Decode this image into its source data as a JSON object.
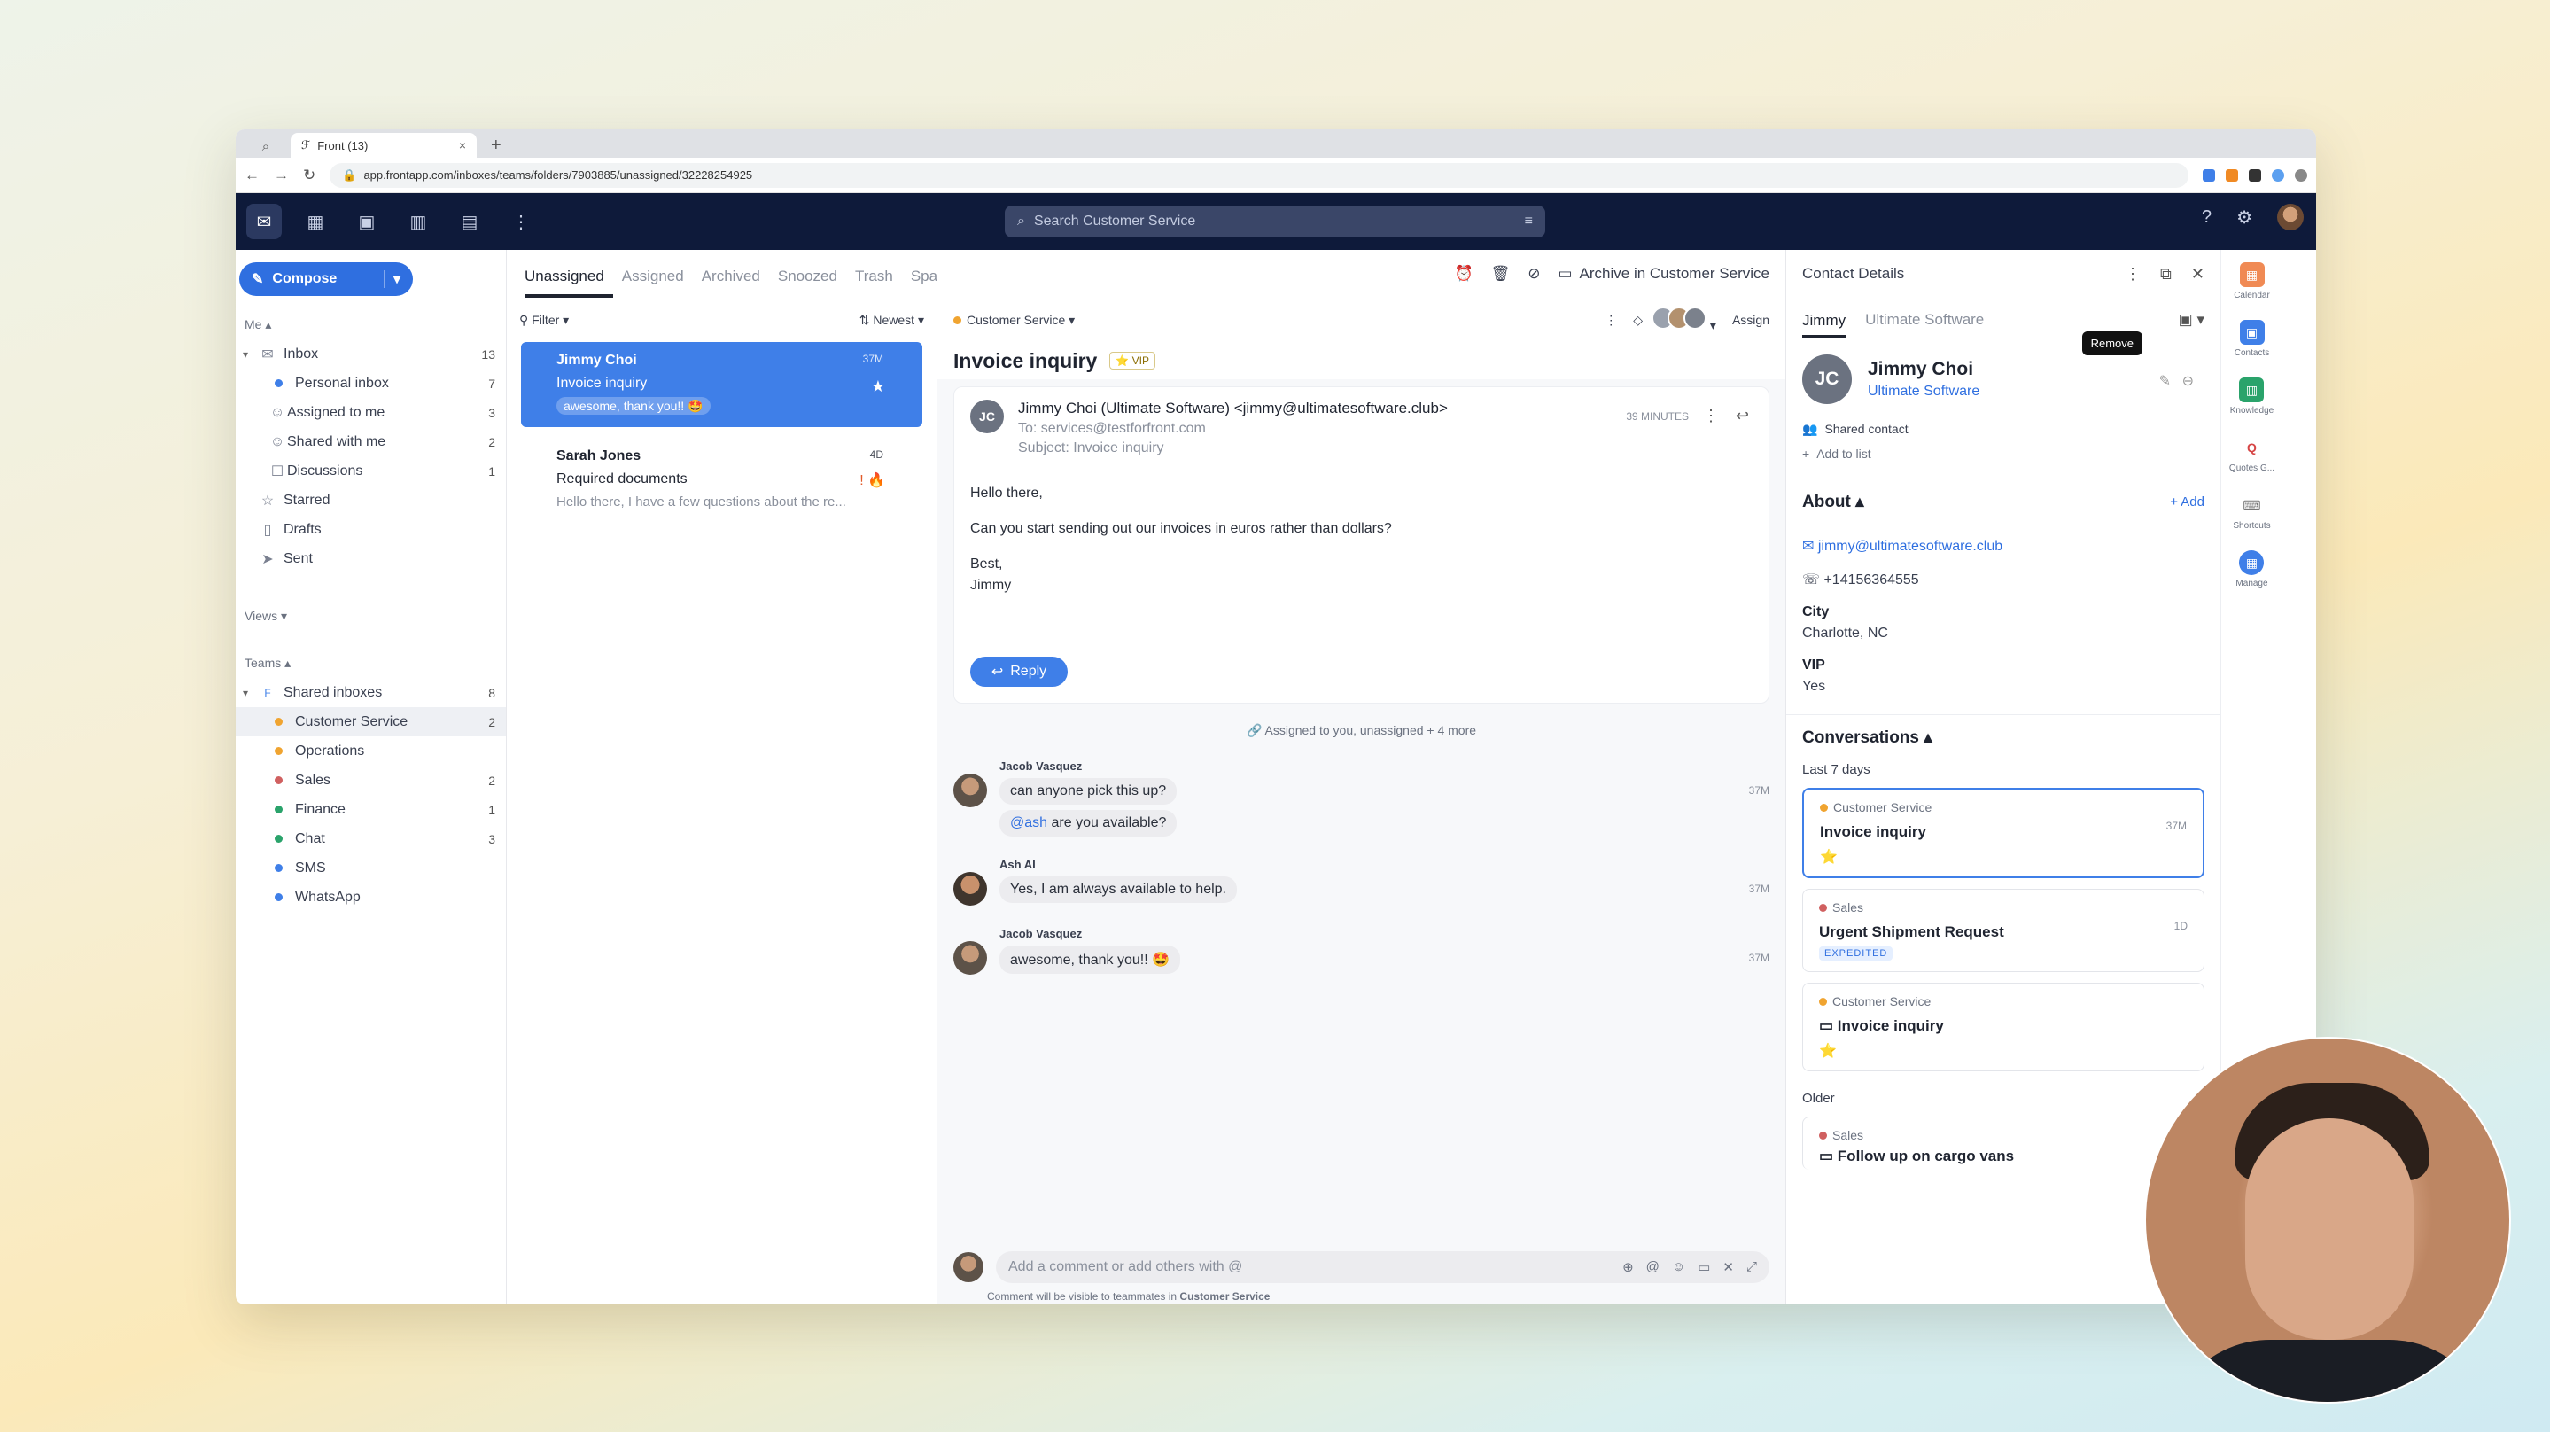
{
  "browser": {
    "tab_title": "Front (13)",
    "url": "app.frontapp.com/inboxes/teams/folders/7903885/unassigned/32228254925"
  },
  "topbar": {
    "search_placeholder": "Search Customer Service"
  },
  "sidebar": {
    "compose_label": "Compose",
    "me_label": "Me",
    "inbox": {
      "label": "Inbox",
      "count": "13"
    },
    "inbox_items": [
      {
        "label": "Personal inbox",
        "count": "7"
      },
      {
        "label": "Assigned to me",
        "count": "3"
      },
      {
        "label": "Shared with me",
        "count": "2"
      },
      {
        "label": "Discussions",
        "count": "1"
      }
    ],
    "starred": "Starred",
    "drafts": "Drafts",
    "sent": "Sent",
    "views_label": "Views",
    "teams_label": "Teams",
    "shared_inboxes": {
      "label": "Shared inboxes",
      "count": "8"
    },
    "teams": [
      {
        "label": "Customer Service",
        "count": "2",
        "color": "#f0a430"
      },
      {
        "label": "Operations",
        "count": "",
        "color": "#f0a430"
      },
      {
        "label": "Sales",
        "count": "2",
        "color": "#d06060"
      },
      {
        "label": "Finance",
        "count": "1",
        "color": "#2aa36b"
      },
      {
        "label": "Chat",
        "count": "3",
        "color": "#2aa36b"
      },
      {
        "label": "SMS",
        "count": "",
        "color": "#3f7fe8"
      },
      {
        "label": "WhatsApp",
        "count": "",
        "color": "#3f7fe8"
      }
    ]
  },
  "list": {
    "tabs": [
      "Unassigned",
      "Assigned",
      "Archived",
      "Snoozed",
      "Trash",
      "Spam"
    ],
    "filter_label": "Filter",
    "sort_label": "Newest",
    "conversations": [
      {
        "name": "Jimmy Choi",
        "subject": "Invoice inquiry",
        "preview": "awesome, thank you!! 🤩",
        "time": "37M"
      },
      {
        "name": "Sarah Jones",
        "subject": "Required documents",
        "preview": "Hello there, I have a few questions about the re...",
        "time": "4D"
      }
    ]
  },
  "conversation": {
    "archive_label": "Archive in Customer Service",
    "inbox_label": "Customer Service",
    "assign_label": "Assign",
    "subject": "Invoice inquiry",
    "vip_badge": "VIP",
    "message": {
      "initials": "JC",
      "from": "Jimmy Choi (Ultimate Software) <jimmy@ultimatesoftware.club>",
      "to": "To: services@testforfront.com",
      "subject_line": "Subject: Invoice inquiry",
      "time": "39 MINUTES",
      "body_greeting": "Hello there,",
      "body_text": "Can you start sending out our invoices in euros rather than dollars?",
      "body_signoff": "Best,",
      "body_name": "Jimmy",
      "reply_label": "Reply"
    },
    "assigned_note": "Assigned to you, unassigned + 4 more",
    "comments": [
      {
        "author": "Jacob Vasquez",
        "text": "can anyone pick this up?",
        "mention": "@ash",
        "mention_rest": " are you available?",
        "time": "37M"
      },
      {
        "author": "Ash AI",
        "text": "Yes, I am always available to help.",
        "time": "37M"
      },
      {
        "author": "Jacob Vasquez",
        "text": "awesome, thank you!! 🤩",
        "time": "37M"
      }
    ],
    "composer_placeholder": "Add a comment or add others with @",
    "composer_note": "Comment will be visible to teammates in",
    "composer_note_team": "Customer Service"
  },
  "contact": {
    "header": "Contact Details",
    "tabs": [
      "Jimmy",
      "Ultimate Software"
    ],
    "initials": "JC",
    "name": "Jimmy Choi",
    "company": "Ultimate Software",
    "tooltip": "Remove",
    "shared_contact": "Shared contact",
    "add_to_list": "Add to list",
    "about_label": "About",
    "add_label": "+ Add",
    "email": "jimmy@ultimatesoftware.club",
    "phone": "+14156364555",
    "city_label": "City",
    "city_value": "Charlotte, NC",
    "vip_label": "VIP",
    "vip_value": "Yes",
    "conversations_label": "Conversations",
    "last7_label": "Last 7 days",
    "older_label": "Older",
    "cards": [
      {
        "team": "Customer Service",
        "title": "Invoice inquiry",
        "time": "37M",
        "badge": ""
      },
      {
        "team": "Sales",
        "title": "Urgent Shipment Request",
        "time": "1D",
        "badge": "EXPEDITED"
      },
      {
        "team": "Customer Service",
        "title": "Invoice inquiry",
        "time": "",
        "badge": ""
      },
      {
        "team": "Sales",
        "title": "Follow up on cargo vans",
        "time": "",
        "badge": ""
      }
    ],
    "rail": [
      "Calendar",
      "Contacts",
      "Knowledge",
      "Quotes G...",
      "Shortcuts",
      "Manage"
    ]
  }
}
